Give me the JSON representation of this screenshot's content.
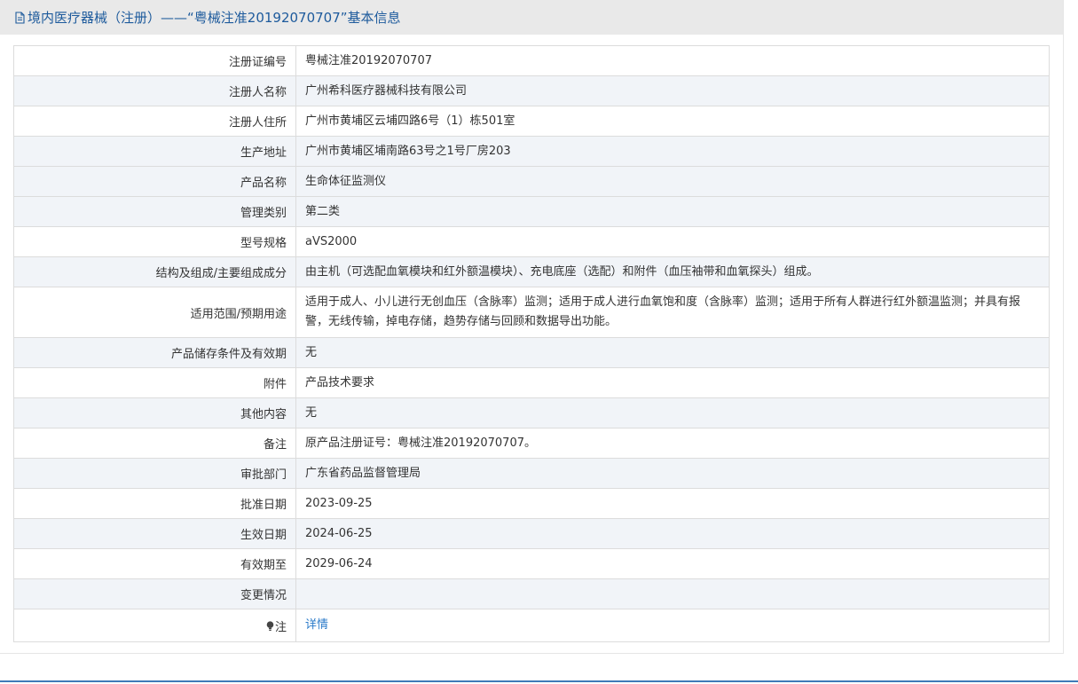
{
  "header": {
    "title": "境内医疗器械（注册）——“粤械注准20192070707”基本信息",
    "icon": "document-icon"
  },
  "rows": [
    {
      "label": "注册证编号",
      "value": "粤械注准20192070707"
    },
    {
      "label": "注册人名称",
      "value": "广州希科医疗器械科技有限公司"
    },
    {
      "label": "注册人住所",
      "value": "广州市黄埔区云埔四路6号（1）栋501室"
    },
    {
      "label": "生产地址",
      "value": "广州市黄埔区埔南路63号之1号厂房203"
    },
    {
      "label": "产品名称",
      "value": "生命体征监测仪"
    },
    {
      "label": "管理类别",
      "value": "第二类"
    },
    {
      "label": "型号规格",
      "value": "aVS2000"
    },
    {
      "label": "结构及组成/主要组成成分",
      "value": "由主机（可选配血氧模块和红外额温模块）、充电底座（选配）和附件（血压袖带和血氧探头）组成。"
    },
    {
      "label": "适用范围/预期用途",
      "value": "适用于成人、小儿进行无创血压（含脉率）监测；适用于成人进行血氧饱和度（含脉率）监测；适用于所有人群进行红外额温监测；并具有报警，无线传输，掉电存储，趋势存储与回顾和数据导出功能。"
    },
    {
      "label": "产品储存条件及有效期",
      "value": "无"
    },
    {
      "label": "附件",
      "value": "产品技术要求"
    },
    {
      "label": "其他内容",
      "value": "无"
    },
    {
      "label": "备注",
      "value": "原产品注册证号：粤械注准20192070707。"
    },
    {
      "label": "审批部门",
      "value": "广东省药品监督管理局"
    },
    {
      "label": "批准日期",
      "value": "2023-09-25"
    },
    {
      "label": "生效日期",
      "value": "2024-06-25"
    },
    {
      "label": "有效期至",
      "value": "2029-06-24"
    },
    {
      "label": "变更情况",
      "value": ""
    }
  ],
  "note": {
    "label": "注",
    "icon": "bulb-icon",
    "link": "详情"
  },
  "colors": {
    "title": "#1d5a9c",
    "header_bg": "#e9e9e9",
    "row_shaded": "#f1f4f8",
    "link": "#2a7ac9",
    "bottom_rule": "#3f7ab8"
  }
}
